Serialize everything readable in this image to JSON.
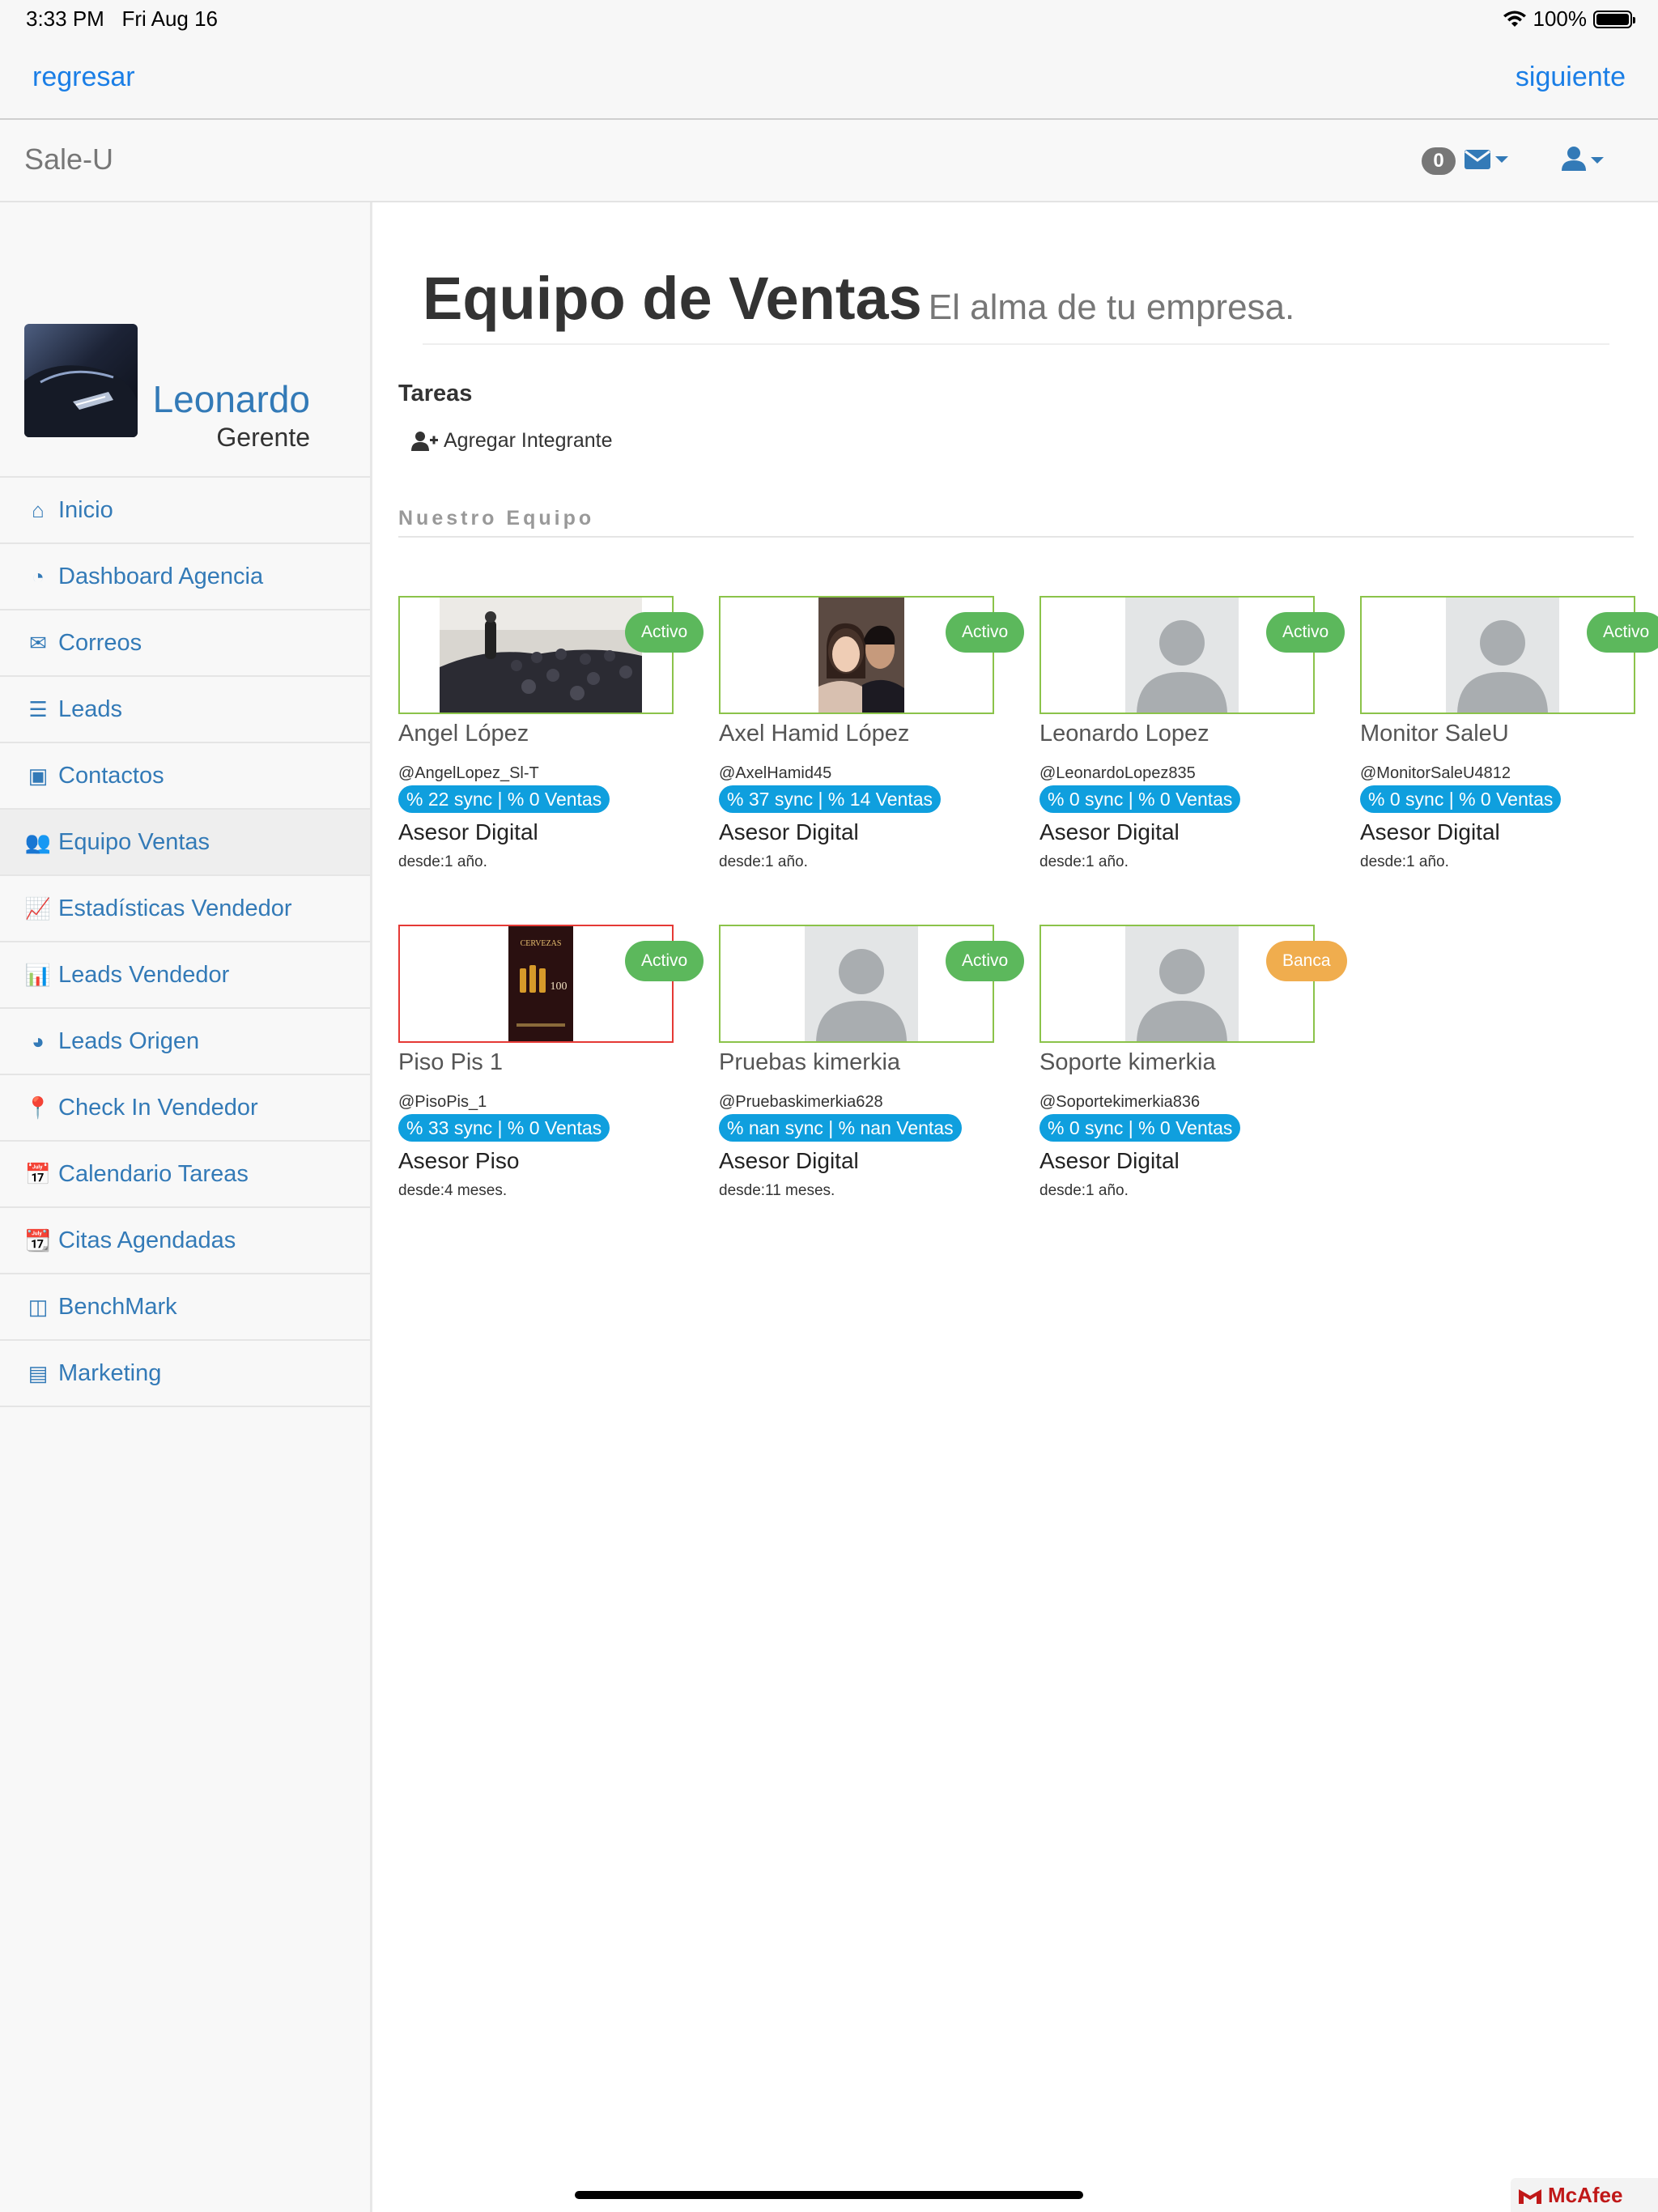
{
  "status_bar": {
    "time": "3:33 PM",
    "date": "Fri Aug 16",
    "battery": "100%"
  },
  "nav": {
    "back": "regresar",
    "next": "siguiente"
  },
  "header": {
    "brand": "Sale-U",
    "mail_count": "0"
  },
  "user": {
    "name": "Leonardo",
    "role": "Gerente"
  },
  "menu": [
    {
      "label": "Inicio",
      "icon": "home-icon",
      "glyph": "⌂"
    },
    {
      "label": "Dashboard Agencia",
      "icon": "dashboard-icon",
      "glyph": "◔"
    },
    {
      "label": "Correos",
      "icon": "envelope-icon",
      "glyph": "✉"
    },
    {
      "label": "Leads",
      "icon": "tasks-icon",
      "glyph": "☰"
    },
    {
      "label": "Contactos",
      "icon": "contact-card-icon",
      "glyph": "▣"
    },
    {
      "label": "Equipo Ventas",
      "icon": "users-icon",
      "glyph": "👥"
    },
    {
      "label": "Estadísticas Vendedor",
      "icon": "line-chart-icon",
      "glyph": "📈"
    },
    {
      "label": "Leads Vendedor",
      "icon": "bar-chart-icon",
      "glyph": "📊"
    },
    {
      "label": "Leads Origen",
      "icon": "pie-chart-icon",
      "glyph": "◕"
    },
    {
      "label": "Check In Vendedor",
      "icon": "map-marker-icon",
      "glyph": "📍"
    },
    {
      "label": "Calendario Tareas",
      "icon": "calendar-plus-icon",
      "glyph": "📅"
    },
    {
      "label": "Citas Agendadas",
      "icon": "calendar-icon",
      "glyph": "📆"
    },
    {
      "label": "BenchMark",
      "icon": "columns-icon",
      "glyph": "◫"
    },
    {
      "label": "Marketing",
      "icon": "list-alt-icon",
      "glyph": "▤"
    }
  ],
  "active_menu": "Equipo Ventas",
  "page": {
    "title": "Equipo de Ventas",
    "subtitle": "El alma de tu empresa.",
    "tasks_heading": "Tareas",
    "add_member": "Agregar Integrante",
    "team_heading": "Nuestro Equipo"
  },
  "team": [
    {
      "name": "Angel López",
      "handle": "@AngelLopez_Sl-T",
      "sync": "% 22 sync | % 0 Ventas",
      "role": "Asesor Digital",
      "since": "desde:1 año.",
      "status": "Activo",
      "photo": "crowd"
    },
    {
      "name": "Axel Hamid López",
      "handle": "@AxelHamid45",
      "sync": "% 37 sync | % 14 Ventas",
      "role": "Asesor Digital",
      "since": "desde:1 año.",
      "status": "Activo",
      "photo": "couple"
    },
    {
      "name": "Leonardo Lopez",
      "handle": "@LeonardoLopez835",
      "sync": "% 0 sync | % 0 Ventas",
      "role": "Asesor Digital",
      "since": "desde:1 año.",
      "status": "Activo",
      "photo": "placeholder"
    },
    {
      "name": "Monitor SaleU",
      "handle": "@MonitorSaleU4812",
      "sync": "% 0 sync | % 0 Ventas",
      "role": "Asesor Digital",
      "since": "desde:1 año.",
      "status": "Activo",
      "photo": "placeholder"
    },
    {
      "name": "Piso Pis 1",
      "handle": "@PisoPis_1",
      "sync": "% 33 sync | % 0 Ventas",
      "role": "Asesor Piso",
      "since": "desde:4 meses.",
      "status": "Activo",
      "photo": "poster"
    },
    {
      "name": "Pruebas kimerkia",
      "handle": "@Pruebaskimerkia628",
      "sync": "% nan sync | % nan Ventas",
      "role": "Asesor Digital",
      "since": "desde:11 meses.",
      "status": "Activo",
      "photo": "placeholder"
    },
    {
      "name": "Soporte kimerkia",
      "handle": "@Soportekimerkia836",
      "sync": "% 0 sync | % 0 Ventas",
      "role": "Asesor Digital",
      "since": "desde:1 año.",
      "status": "Banca",
      "photo": "placeholder"
    }
  ],
  "poster_text": {
    "line1": "CERVEZAS",
    "line2": "100"
  },
  "watermark": {
    "brand": "McAfee"
  },
  "colors": {
    "link": "#337ab7",
    "ios_blue": "#1a7ee6",
    "active_green": "#5cb85c",
    "banca_orange": "#f0ad4e",
    "sync_blue": "#0f9fde",
    "frame_green": "#8bc34a",
    "frame_red": "#e53935"
  }
}
